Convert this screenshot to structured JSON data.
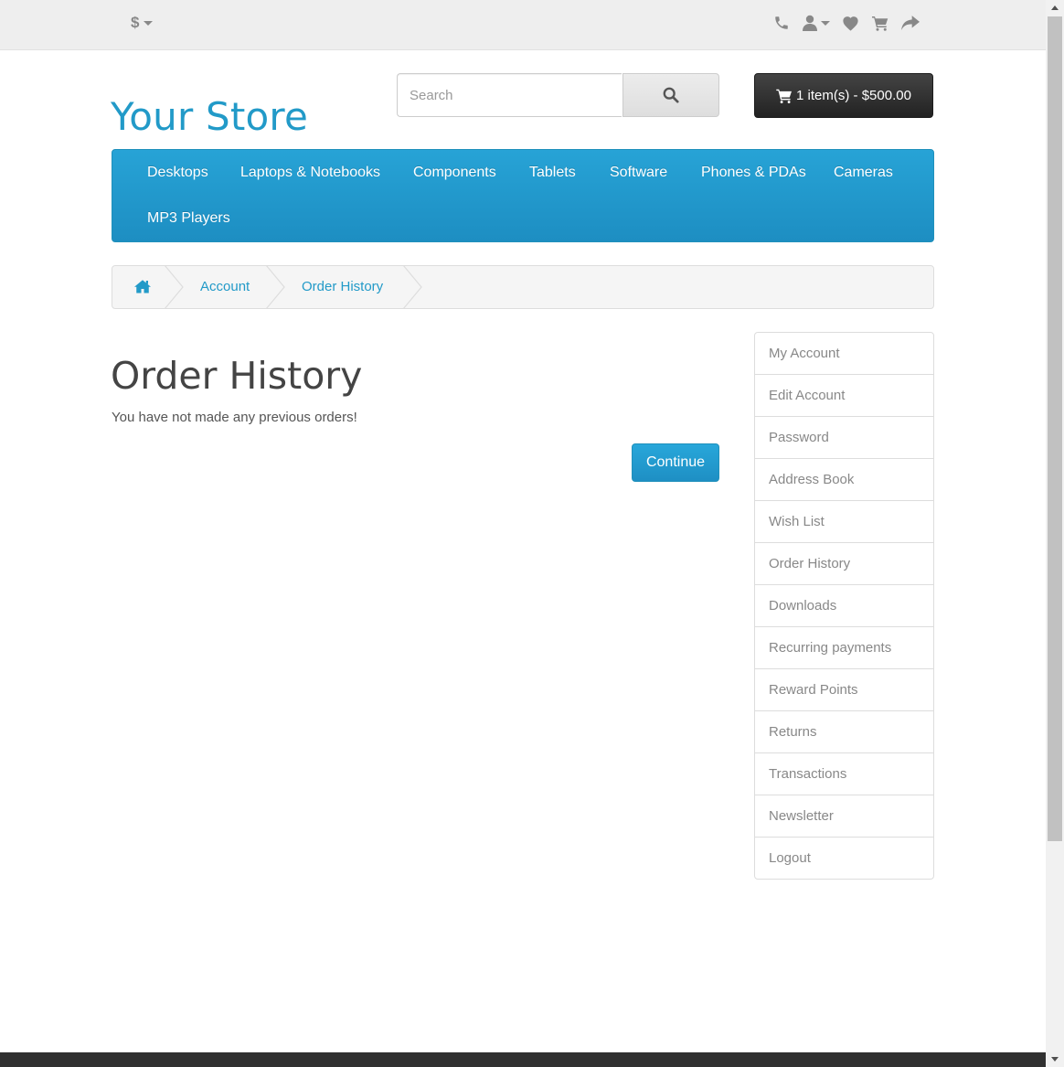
{
  "topbar": {
    "currency_symbol": "$",
    "icons": [
      "phone-icon",
      "user-icon",
      "heart-icon",
      "cart-icon",
      "share-icon"
    ]
  },
  "header": {
    "logo_text": "Your Store",
    "search_placeholder": "Search",
    "cart_label": "1 item(s) - $500.00"
  },
  "menu": {
    "items": [
      "Desktops",
      "Laptops & Notebooks",
      "Components",
      "Tablets",
      "Software",
      "Phones & PDAs",
      "Cameras",
      "MP3 Players"
    ]
  },
  "breadcrumb": {
    "items": [
      "Account",
      "Order History"
    ]
  },
  "main": {
    "title": "Order History",
    "empty_message": "You have not made any previous orders!",
    "continue_label": "Continue"
  },
  "sidebar": {
    "items": [
      "My Account",
      "Edit Account",
      "Password",
      "Address Book",
      "Wish List",
      "Order History",
      "Downloads",
      "Recurring payments",
      "Reward Points",
      "Returns",
      "Transactions",
      "Newsletter",
      "Logout"
    ]
  },
  "colors": {
    "accent": "#229ac8",
    "menu_bg": "#229ac8",
    "cart_bg": "#303030",
    "topbar_bg": "#eeeeee"
  }
}
